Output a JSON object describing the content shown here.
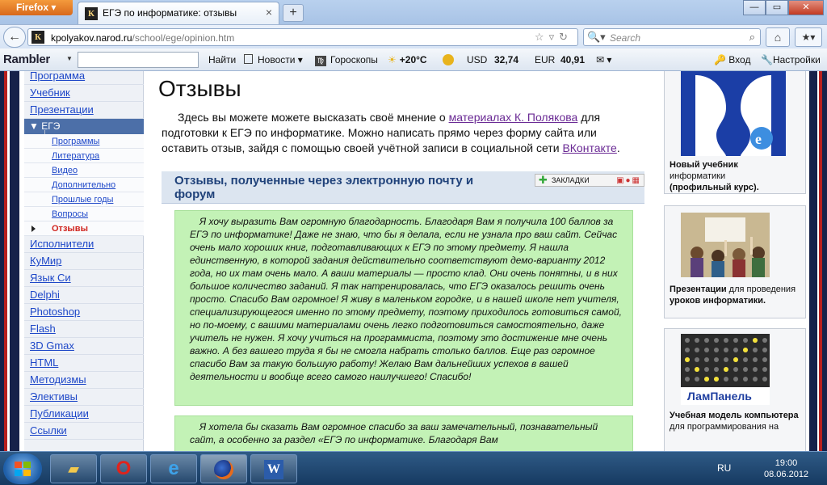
{
  "browser": {
    "menu_label": "Firefox",
    "tab_title": "ЕГЭ по информатике: отзывы",
    "tab_favicon": "К",
    "url_host": "kpolyakov.narod.ru",
    "url_path": "/school/ege/opinion.htm",
    "search_placeholder": "Search"
  },
  "rambler": {
    "logo": "Rambler",
    "find": "Найти",
    "news": "Новости",
    "horoscopes": "Гороскопы",
    "temperature": "+20°C",
    "usd_label": "USD",
    "usd_value": "32,74",
    "eur_label": "EUR",
    "eur_value": "40,91",
    "login": "Вход",
    "settings": "Настройки"
  },
  "leftnav": {
    "items_top": [
      "Программа",
      "Учебник",
      "Презентации"
    ],
    "ege_label": "ЕГЭ",
    "sub_items": [
      "Программы",
      "Литература",
      "Видео",
      "Дополнительно",
      "Прошлые годы",
      "Вопросы"
    ],
    "current_sub": "Отзывы",
    "items_bottom": [
      "Исполнители",
      "КуМир",
      "Язык Си",
      "Delphi",
      "Photoshop",
      "Flash",
      "3D Gmax",
      "HTML",
      "Методизмы",
      "Элективы",
      "Публикации",
      "Ссылки"
    ]
  },
  "main": {
    "title": "Отзывы",
    "intro_1": "Здесь вы можете можете высказать своё мнение о ",
    "intro_link1": "материалах К. Полякова",
    "intro_2": " для подготовки к ЕГЭ по информатике. Можно написать прямо через форму сайта или оставить отзыв, зайдя с помощью своей учётной записи в социальной сети ",
    "intro_link2": "ВКонтакте",
    "intro_3": ".",
    "section_title": "Отзывы, полученные через электронную почту и форум",
    "bookmarks_label": "ЗАКЛАДКИ",
    "review1": "Я хочу выразить Вам огромную благодарность. Благодаря Вам я получила 100 баллов за ЕГЭ по информатике! Даже не знаю, что бы я делала, если не узнала про ваш сайт. Сейчас очень мало хороших книг, подготавливающих к ЕГЭ по этому предмету. Я нашла единственную, в которой задания действительно соответствуют демо-варианту 2012 года, но их там очень мало. А ваши материалы — просто клад. Они очень понятны, и в них большое количество заданий. Я так натренировалась, что ЕГЭ оказалось решить очень просто. Спасибо Вам огромное! Я живу в маленьком городке, и в нашей школе нет учителя, специализирующегося именно по этому предмету, поэтому приходилось готовиться самой, но по-моему, с вашими материалами очень легко подготовиться самостоятельно, даже учитель не нужен. Я хочу учиться на программиста, поэтому это достижение мне очень важно. А без вашего труда я бы не смогла набрать столько баллов. Еще раз огромное спасибо Вам за такую большую работу! Желаю Вам дальнейших успехов в вашей деятельности и вообще всего самого наилучшего! Спасибо!",
    "review2": "Я хотела бы сказать Вам огромное спасибо за ваш замечательный, познавательный сайт, а особенно за раздел «ЕГЭ по информатике. Благодаря Вам"
  },
  "right": {
    "card1_bold1": "Новый учебник",
    "card1_text": "информатики",
    "card1_bold2": "(профильный курс).",
    "card2_bold1": "Презентации",
    "card2_text1": " для проведения ",
    "card2_bold2": "уроков информатики.",
    "card3_logo": "ЛамПанель",
    "card3_bold": "Учебная модель компьютера",
    "card3_text": " для программирования на"
  },
  "taskbar": {
    "lang": "RU",
    "time": "19:00",
    "date": "08.06.2012",
    "word_icon": "W"
  }
}
